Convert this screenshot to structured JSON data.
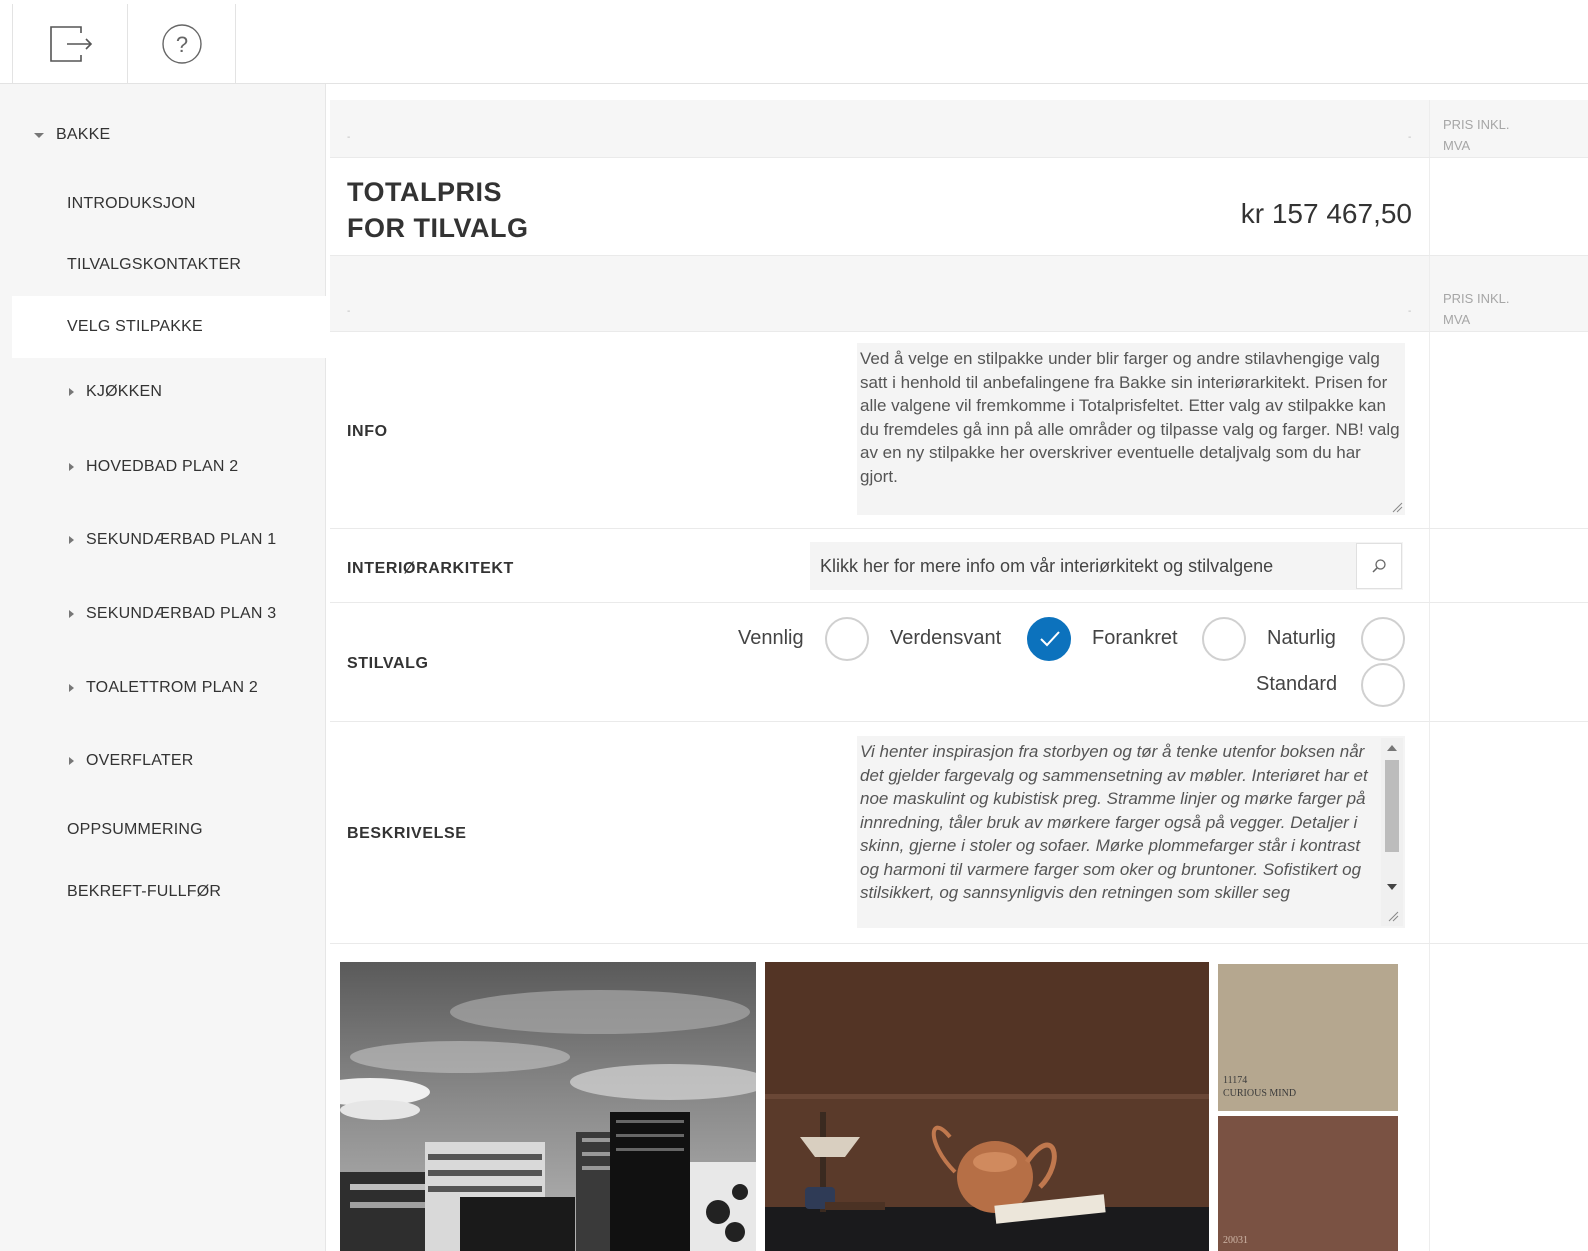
{
  "topbar": {
    "logout_icon": "logout-icon",
    "help_icon": "help-icon"
  },
  "sidebar": {
    "root_label": "BAKKE",
    "items": [
      {
        "label": "INTRODUKSJON"
      },
      {
        "label": "TILVALGSKONTAKTER"
      },
      {
        "label": "VELG STILPAKKE"
      },
      {
        "label": "KJØKKEN"
      },
      {
        "label": "HOVEDBAD PLAN 2"
      },
      {
        "label": "SEKUNDÆRBAD PLAN 1"
      },
      {
        "label": "SEKUNDÆRBAD PLAN 3"
      },
      {
        "label": "TOALETTROM PLAN 2"
      },
      {
        "label": "OVERFLATER"
      },
      {
        "label": "OPPSUMMERING"
      },
      {
        "label": "BEKREFT-FULLFØR"
      }
    ]
  },
  "main": {
    "price_header_1": "PRIS INKL.",
    "price_header_2": "MVA",
    "header_dot": "-",
    "total_title_1": "TOTALPRIS",
    "total_title_2": "FOR TILVALG",
    "total_value": "kr 157 467,50",
    "info_label": "INFO",
    "info_text": "Ved å velge en stilpakke under blir farger og andre stilavhengige valg satt i henhold til anbefalingene fra Bakke sin interiørarkitekt. Prisen for alle valgene vil fremkomme i Totalprisfeltet. Etter valg av stilpakke kan du fremdeles gå inn på alle områder og tilpasse valg og farger. NB! valg av en ny stilpakke her overskriver eventuelle detaljvalg som du har gjort.",
    "architect_label": "INTERIØRARKITEKT",
    "architect_link": "Klikk her for mere info om vår interiørkitekt og stilvalgene",
    "style_label": "STILVALG",
    "style_options": [
      {
        "label": "Vennlig",
        "checked": false
      },
      {
        "label": "Verdensvant",
        "checked": true
      },
      {
        "label": "Forankret",
        "checked": false
      },
      {
        "label": "Naturlig",
        "checked": false
      },
      {
        "label": "Standard",
        "checked": false
      }
    ],
    "description_label": "BESKRIVELSE",
    "description_text": "Vi henter inspirasjon fra storbyen og tør å tenke utenfor boksen når det gjelder fargevalg og sammensetning av møbler. Interiøret har et noe maskulint og kubistisk preg. Stramme linjer og mørke farger på innredning, tåler bruk av mørkere farger også på vegger. Detaljer i skinn, gjerne i stoler og sofaer. Mørke plommefarger står i kontrast og harmoni til varmere farger som oker og bruntoner. Sofistikert og stilsikkert, og sannsynligvis den retningen som skiller seg",
    "swatch1_code": "11174",
    "swatch1_name": "CURIOUS MIND",
    "swatch2_code": "20031",
    "colors": {
      "accent": "#0c72bd",
      "sidebar_bg": "#f6f6f6",
      "swatch1": "#b5a78f",
      "swatch2": "#7a5243"
    }
  }
}
